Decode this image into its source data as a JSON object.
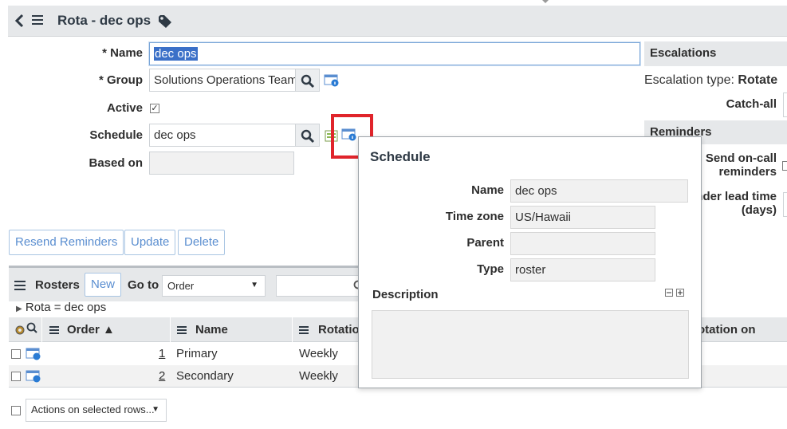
{
  "header": {
    "title": "Rota - dec ops",
    "icons": [
      "back-icon",
      "hamburger-icon",
      "tag-icon"
    ]
  },
  "form": {
    "name_label": "* Name",
    "name_value": "dec ops",
    "group_label": "* Group",
    "group_value": "Solutions Operations Team",
    "active_label": "Active",
    "active_checked": true,
    "schedule_label": "Schedule",
    "schedule_value": "dec ops",
    "based_on_label": "Based on",
    "based_on_value": ""
  },
  "actions": {
    "resend": "Resend Reminders",
    "update": "Update",
    "delete": "Delete"
  },
  "right_panel": {
    "escalations_header": "Escalations",
    "escalation_type_label": "Escalation type:",
    "escalation_type_value": "Rotate",
    "catch_all_label": "Catch-all",
    "reminders_header": "Reminders",
    "send_oncall_label_1": "Send on-call",
    "send_oncall_label_2": "reminders",
    "lead_time_label_1": "nder lead time",
    "lead_time_label_2": "(days)"
  },
  "related_list": {
    "title": "Rosters",
    "new_button": "New",
    "goto_label": "Go to",
    "goto_select": "Order",
    "breadcrumb": "Rota = dec ops",
    "columns": {
      "order": "Order ▲",
      "name": "Name",
      "rotation": "Rotatio",
      "rotation_on": "otation on"
    },
    "rows": [
      {
        "order": "1",
        "name": "Primary",
        "rotation": "Weekly"
      },
      {
        "order": "2",
        "name": "Secondary",
        "rotation": "Weekly"
      }
    ],
    "actions_select": "Actions on selected rows..."
  },
  "popup": {
    "title": "Schedule",
    "name_label": "Name",
    "name_value": "dec ops",
    "timezone_label": "Time zone",
    "timezone_value": "US/Hawaii",
    "parent_label": "Parent",
    "parent_value": "",
    "type_label": "Type",
    "type_value": "roster",
    "description_label": "Description",
    "description_value": ""
  },
  "colors": {
    "accent": "#5a8ed0",
    "highlight": "#e0242b",
    "header_bg": "#e6e8ea"
  }
}
